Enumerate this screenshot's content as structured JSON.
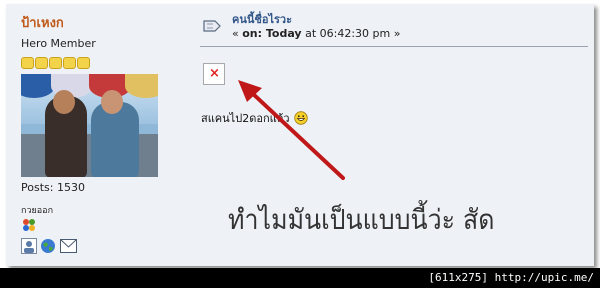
{
  "poster": {
    "name": "ป้าเหงก",
    "title": "Hero Member",
    "star_count": 5,
    "posts": "Posts: 1530",
    "status": "กวยออก"
  },
  "post": {
    "subject": "คนนี้ชื่อไรวะ",
    "date_prefix": "« ",
    "date_on": "on: Today",
    "date_time": " at 06:42:30 pm »",
    "body": "สแคนไป2ดอกแล้ว"
  },
  "annotation": "ทำไมมันเป็นแบบนี้ว่ะ สัด",
  "footer": "[611x275] http://upic.me/",
  "colors": {
    "poster_name": "#c05a1a",
    "subject": "#34578a",
    "arrow": "#c01818",
    "background": "#eef2f6"
  },
  "icons": [
    "topic-icon",
    "broken-image-icon",
    "grin-smiley-icon",
    "msn-icon",
    "profile-icon",
    "website-icon",
    "email-icon",
    "star-icon"
  ]
}
